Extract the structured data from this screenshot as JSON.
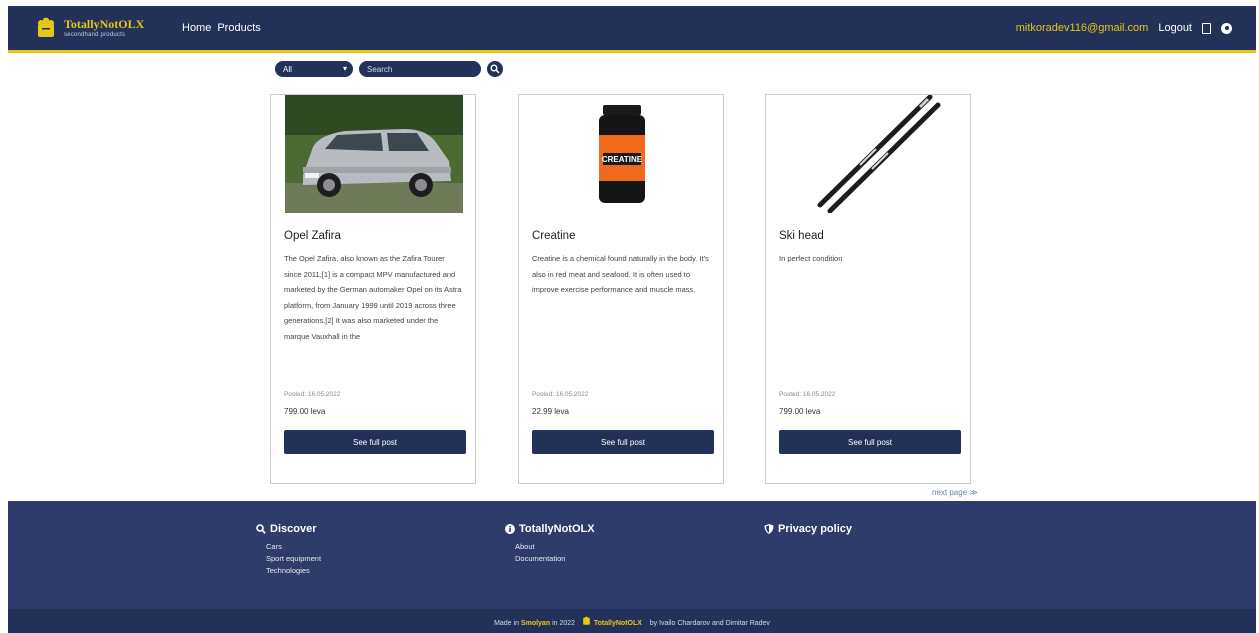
{
  "navbar": {
    "brand_name": "TotallyNotOLX",
    "brand_sub": "secondhand products",
    "links": [
      "Home",
      "Products"
    ],
    "user_email": "mitkoradev116@gmail.com",
    "logout_label": "Logout",
    "icons": [
      "bookmark-icon",
      "gear-icon"
    ]
  },
  "filters": {
    "category_value": "All",
    "search_placeholder": "Search"
  },
  "products": [
    {
      "title": "Opel Zafira",
      "description": "The Opel Zafira, also known as the Zafira Tourer since 2011,[1] is a compact MPV manufactured and marketed by the German automaker Opel on its Astra platform, from January 1999 until 2019 across three generations.[2] It was also marketed under the marque Vauxhall in the",
      "posted": "Posted: 16.05.2022",
      "price": "799.00 leva",
      "button": "See full post"
    },
    {
      "title": "Creatine",
      "description": "Creatine is a chemical found naturally in the body. It's also in red meat and seafood. It is often used to improve exercise performance and muscle mass.",
      "posted": "Posted: 16.05.2022",
      "price": "22.99 leva",
      "button": "See full post"
    },
    {
      "title": "Ski head",
      "description": "In perfect condition",
      "posted": "Posted: 16.05.2022",
      "price": "799.00 leva",
      "button": "See full post"
    }
  ],
  "pagination": {
    "next_label": "next page ≫"
  },
  "footer": {
    "columns": [
      {
        "heading": "Discover",
        "icon": "search-icon",
        "links": [
          "Cars",
          "Sport equipment",
          "Technologies"
        ]
      },
      {
        "heading": "TotallyNotOLX",
        "icon": "info-icon",
        "links": [
          "About",
          "Documentation"
        ]
      },
      {
        "heading": "Privacy policy",
        "icon": "shield-icon",
        "links": []
      }
    ],
    "copyright": {
      "made_in": "Made in",
      "place": "Smolyan",
      "year": "in 2022",
      "brand": "TotallyNotOLX",
      "by": "by Ivailo Chardarov and Dimitar Radev"
    }
  },
  "colors": {
    "primary": "#233159",
    "accent": "#e6c619",
    "footer": "#2f3b6a"
  }
}
